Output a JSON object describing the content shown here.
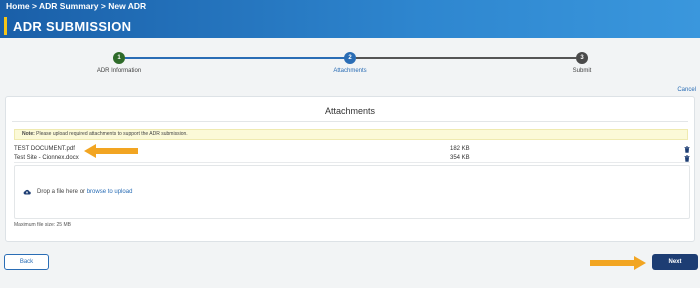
{
  "breadcrumb": {
    "home": "Home",
    "sep1": " > ",
    "summary": "ADR Summary",
    "sep2": " > ",
    "current": "New ADR"
  },
  "page_title": "ADR SUBMISSION",
  "stepper": {
    "steps": [
      {
        "number": "1",
        "label": "ADR Information",
        "state": "completed",
        "color": "#2e6b2a"
      },
      {
        "number": "2",
        "label": "Attachments",
        "state": "active",
        "color": "#2a6db5"
      },
      {
        "number": "3",
        "label": "Submit",
        "state": "pending",
        "color": "#4a4a4a"
      }
    ]
  },
  "cancel_label": "Cancel",
  "attachments": {
    "title": "Attachments",
    "note_label": "Note:",
    "note_text": " Please upload required attachments to support the ADR submission.",
    "files": [
      {
        "name": "TEST DOCUMENT.pdf",
        "size": "182 KB"
      },
      {
        "name": "Test Site - Cionnex.docx",
        "size": "354 KB"
      }
    ],
    "dropzone": {
      "text": "Drop a file here or ",
      "link": "browse to upload"
    },
    "max_size": "Maximum file size: 25 MB"
  },
  "footer": {
    "back_label": "Back",
    "next_label": "Next"
  },
  "colors": {
    "header_blue": "#1a5fa8",
    "accent_yellow": "#f5c518",
    "primary_navy": "#1d3d73",
    "link_blue": "#2a6db5",
    "annotation_arrow": "#f2a522"
  }
}
